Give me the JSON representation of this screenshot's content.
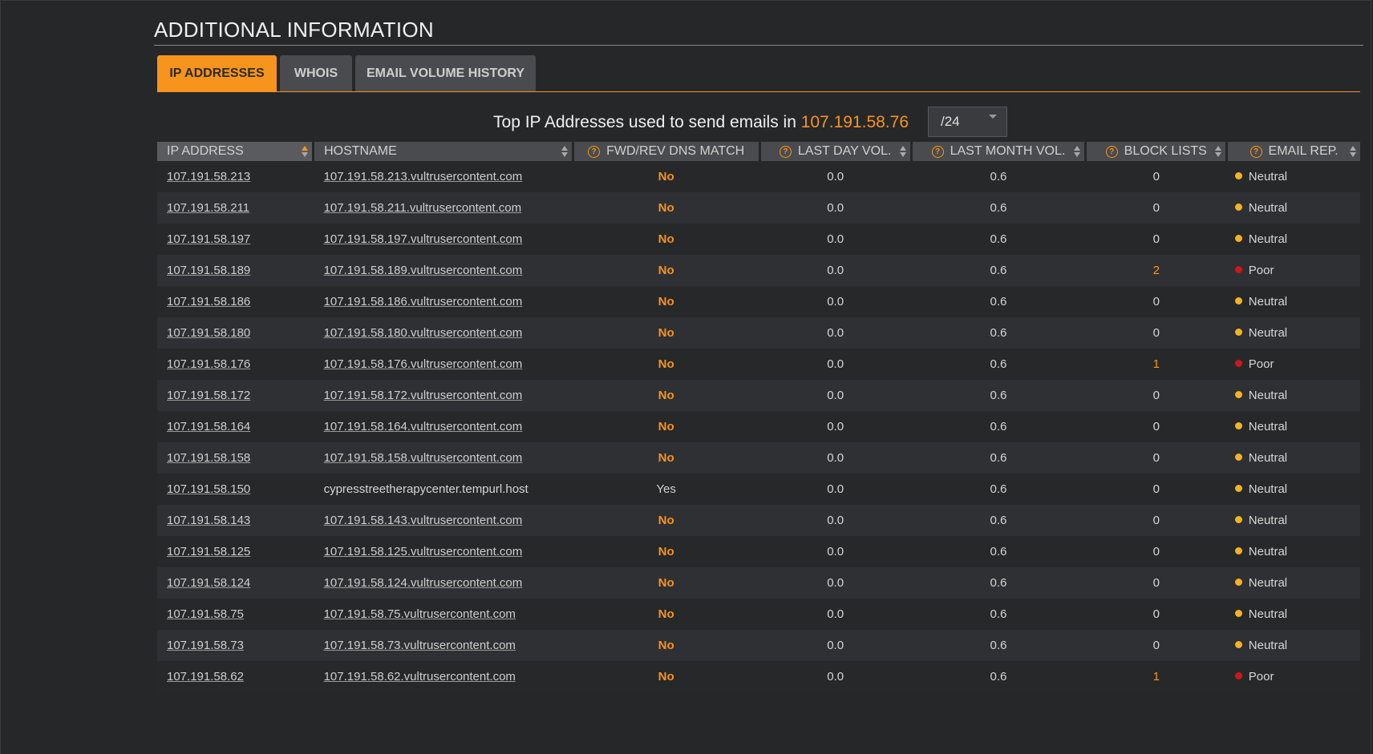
{
  "section_title": "ADDITIONAL INFORMATION",
  "tabs": [
    {
      "label": "IP ADDRESSES",
      "active": true
    },
    {
      "label": "WHOIS",
      "active": false
    },
    {
      "label": "EMAIL VOLUME HISTORY",
      "active": false
    }
  ],
  "heading": {
    "prefix": "Top IP Addresses used to send emails in ",
    "ip": "107.191.58.76",
    "subnet_value": "/24"
  },
  "columns": {
    "ip": "IP ADDRESS",
    "host": "HOSTNAME",
    "dns": "FWD/REV DNS MATCH",
    "day": "LAST DAY VOL.",
    "month": "LAST MONTH VOL.",
    "block": "BLOCK LISTS",
    "rep": "EMAIL REP."
  },
  "colors": {
    "accent": "#f7941e",
    "neutral": "#f5b323",
    "poor": "#d0161b"
  },
  "rows": [
    {
      "ip": "107.191.58.213",
      "host": "107.191.58.213.vultrusercontent.com",
      "dns": "No",
      "day": "0.0",
      "month": "0.6",
      "block": "0",
      "rep": "Neutral"
    },
    {
      "ip": "107.191.58.211",
      "host": "107.191.58.211.vultrusercontent.com",
      "dns": "No",
      "day": "0.0",
      "month": "0.6",
      "block": "0",
      "rep": "Neutral"
    },
    {
      "ip": "107.191.58.197",
      "host": "107.191.58.197.vultrusercontent.com",
      "dns": "No",
      "day": "0.0",
      "month": "0.6",
      "block": "0",
      "rep": "Neutral"
    },
    {
      "ip": "107.191.58.189",
      "host": "107.191.58.189.vultrusercontent.com",
      "dns": "No",
      "day": "0.0",
      "month": "0.6",
      "block": "2",
      "rep": "Poor"
    },
    {
      "ip": "107.191.58.186",
      "host": "107.191.58.186.vultrusercontent.com",
      "dns": "No",
      "day": "0.0",
      "month": "0.6",
      "block": "0",
      "rep": "Neutral"
    },
    {
      "ip": "107.191.58.180",
      "host": "107.191.58.180.vultrusercontent.com",
      "dns": "No",
      "day": "0.0",
      "month": "0.6",
      "block": "0",
      "rep": "Neutral"
    },
    {
      "ip": "107.191.58.176",
      "host": "107.191.58.176.vultrusercontent.com",
      "dns": "No",
      "day": "0.0",
      "month": "0.6",
      "block": "1",
      "rep": "Poor"
    },
    {
      "ip": "107.191.58.172",
      "host": "107.191.58.172.vultrusercontent.com",
      "dns": "No",
      "day": "0.0",
      "month": "0.6",
      "block": "0",
      "rep": "Neutral"
    },
    {
      "ip": "107.191.58.164",
      "host": "107.191.58.164.vultrusercontent.com",
      "dns": "No",
      "day": "0.0",
      "month": "0.6",
      "block": "0",
      "rep": "Neutral"
    },
    {
      "ip": "107.191.58.158",
      "host": "107.191.58.158.vultrusercontent.com",
      "dns": "No",
      "day": "0.0",
      "month": "0.6",
      "block": "0",
      "rep": "Neutral"
    },
    {
      "ip": "107.191.58.150",
      "host": "cypresstreetherapycenter.tempurl.host",
      "dns": "Yes",
      "day": "0.0",
      "month": "0.6",
      "block": "0",
      "rep": "Neutral"
    },
    {
      "ip": "107.191.58.143",
      "host": "107.191.58.143.vultrusercontent.com",
      "dns": "No",
      "day": "0.0",
      "month": "0.6",
      "block": "0",
      "rep": "Neutral"
    },
    {
      "ip": "107.191.58.125",
      "host": "107.191.58.125.vultrusercontent.com",
      "dns": "No",
      "day": "0.0",
      "month": "0.6",
      "block": "0",
      "rep": "Neutral"
    },
    {
      "ip": "107.191.58.124",
      "host": "107.191.58.124.vultrusercontent.com",
      "dns": "No",
      "day": "0.0",
      "month": "0.6",
      "block": "0",
      "rep": "Neutral"
    },
    {
      "ip": "107.191.58.75",
      "host": "107.191.58.75.vultrusercontent.com",
      "dns": "No",
      "day": "0.0",
      "month": "0.6",
      "block": "0",
      "rep": "Neutral"
    },
    {
      "ip": "107.191.58.73",
      "host": "107.191.58.73.vultrusercontent.com",
      "dns": "No",
      "day": "0.0",
      "month": "0.6",
      "block": "0",
      "rep": "Neutral"
    },
    {
      "ip": "107.191.58.62",
      "host": "107.191.58.62.vultrusercontent.com",
      "dns": "No",
      "day": "0.0",
      "month": "0.6",
      "block": "1",
      "rep": "Poor"
    }
  ]
}
